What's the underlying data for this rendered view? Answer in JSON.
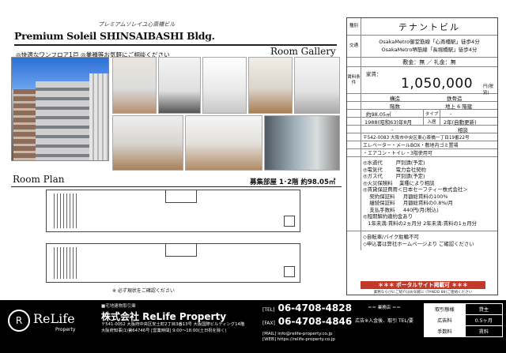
{
  "header": {
    "subtitle_script": "プレミアムソレイユ心斎橋ビル",
    "title": "Premium Soleil SHINSAIBASHI Bldg.",
    "catch_copy": "◎快適なワンフロア1戸 ◎業種等お気軽にご相談ください",
    "gallery_title": "Room Gallery"
  },
  "plan": {
    "title": "Room Plan",
    "scope": "募集部屋 1･2階 約98.05㎡",
    "note": "※ 必ず現状をご確認ください"
  },
  "info": {
    "type_label": "種別",
    "type_value": "テナントビル",
    "traffic_label": "交通",
    "traffic_1": "OsakaMetro御堂筋線「心斎橋駅」徒歩4分",
    "traffic_2": "OsakaMetro堺筋線「長堀橋駅」徒歩4分",
    "deposit": "敷金：無 ／ 礼金：無",
    "rent_side_label": "賃料条件",
    "rent_label": "家賃：",
    "rent_value": "1,050,000",
    "rent_unit": "円(税別)",
    "row_structure": [
      "構造",
      "鉄骨造"
    ],
    "row_floor_label": "階数",
    "row_floor_value": "地上 6 階建",
    "row_area": [
      "約98.05㎡"
    ],
    "row_area_type_label": "タイプ",
    "row_area_type_value": "-",
    "row_built": "1988(昭和63)年8月",
    "row_moveinlabel": "入居",
    "row_movein": "2年(自動更新)",
    "row_parking": "-",
    "row_parking_right": "相談",
    "address": "〒542-0083 大阪市中央区東心斎橋一丁目19番22号",
    "facilities": "エレベーター・メールBOX・敷地内ゴミ置場",
    "equipment": "・エアコン・トイレ・3階使用可",
    "utilities": [
      "◎水道代 　　 戸別請(予定)",
      "◎電気代 　　 電力会社契約",
      "◎ガス代 　　 戸別請(予定)",
      "◎火災保険料 　業種により相談",
      "◎賃貸保証費用＜日本セーフティー株式会社＞",
      "　 契約保証料 　 月額総賃料の100%",
      "　 継続保証料 　 月額総賃料の0.8%/月",
      "　 支払手数料 　 440円/月(税込)",
      "◎短期解約違約金あり",
      "　1年未満:賃料の2ヵ月分 2年未満:賃料の1ヵ月分"
    ],
    "notes": [
      "◇自転車/バイク駐輪不可",
      "◇申込書は弊社ホームページより ご確認ください"
    ],
    "portal": "＊＊＊ ポータルサイト掲載可 ＊＊＊",
    "portal_sub": "業務ならびにご紹介はお気軽に (TANDD 88)ご連絡ください"
  },
  "footer": {
    "logo": "ReLife",
    "logo_sub": "Property",
    "license": "■宅地建物取引業",
    "company": "株式会社 ReLife Property",
    "address": "〒541-0052 大阪府中央区安土町2丁目3番13号 大阪国際ビルディング14階",
    "license_no": "大阪府知事(1)第64746号 [営業時間] 9:00〜18:00(土日祝を除く)",
    "tel_tag": "[TEL]",
    "tel": "06-4708-4828",
    "fax_tag": "[FAX]",
    "fax": "06-4708-4846",
    "mail": "[MAIL] info@relife-property.co.jp",
    "web": "[WEB] https://relife-property.co.jp",
    "store_header": "＝＝ 業務店 ＝＝",
    "store_name": "広告※入金後、取引 TEL/要",
    "terms": [
      [
        "取引態様",
        "貸主"
      ],
      [
        "広告料",
        "0.5ヶ月"
      ],
      [
        "手数料",
        "賃料"
      ]
    ]
  }
}
